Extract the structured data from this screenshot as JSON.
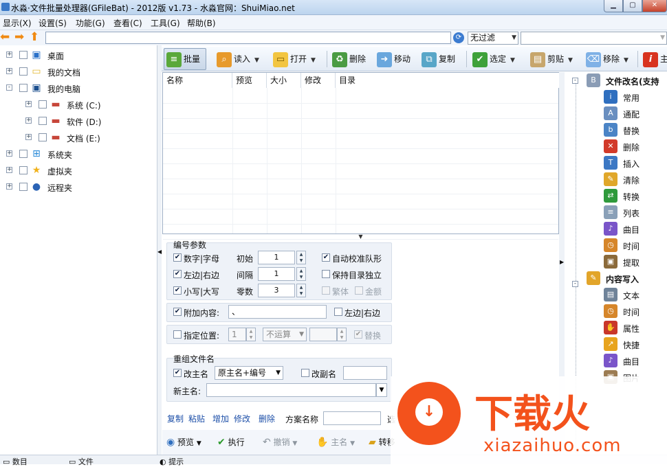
{
  "window": {
    "title": "水淼·文件批量处理器(GFileBat) - 2012版 v1.73 - 水淼官网：ShuiMiao.net"
  },
  "menu": [
    "显示(X)",
    "设置(S)",
    "功能(G)",
    "查看(C)",
    "工具(G)",
    "帮助(B)"
  ],
  "nav": {
    "path_value": "",
    "filter_value": "无过滤",
    "filter2_value": ""
  },
  "tree": [
    {
      "label": "桌面",
      "icon": "desktop-icon",
      "level": 0,
      "expand": "+"
    },
    {
      "label": "我的文档",
      "icon": "folder-icon",
      "level": 0,
      "expand": "+"
    },
    {
      "label": "我的电脑",
      "icon": "computer-icon",
      "level": 0,
      "expand": "-"
    },
    {
      "label": "系统 (C:)",
      "icon": "drive-icon",
      "level": 1,
      "expand": "+"
    },
    {
      "label": "软件 (D:)",
      "icon": "drive-icon",
      "level": 1,
      "expand": "+"
    },
    {
      "label": "文档 (E:)",
      "icon": "drive-icon",
      "level": 1,
      "expand": "+"
    },
    {
      "label": "系统夹",
      "icon": "windows-icon",
      "level": 0,
      "expand": "+"
    },
    {
      "label": "虚拟夹",
      "icon": "star-icon",
      "level": 0,
      "expand": "+"
    },
    {
      "label": "远程夹",
      "icon": "ftp-icon",
      "level": 0,
      "expand": "+"
    }
  ],
  "toolbar": {
    "batch": "批量",
    "read": "读入",
    "open": "打开",
    "delete": "删除",
    "move": "移动",
    "copy": "复制",
    "select": "选定",
    "clip": "剪贴",
    "remove": "移除",
    "info": "主"
  },
  "filelist": {
    "columns": [
      "名称",
      "预览",
      "大小",
      "修改",
      "目录"
    ]
  },
  "params": {
    "number_title": "编号参数",
    "digit_letter": "数字|字母",
    "left_right": "左边|右边",
    "lower_upper": "小写|大写",
    "start_label": "初始",
    "start_value": "1",
    "interval_label": "间隔",
    "interval_value": "1",
    "zeros_label": "零数",
    "zeros_value": "3",
    "auto_align": "自动校准队形",
    "keep_dir": "保持目录独立",
    "traditional": "繁体",
    "money": "金额",
    "append_label": "附加内容:",
    "append_value": "、",
    "append_left_right": "左边|右边",
    "position_label": "指定位置:",
    "position_value": "1",
    "operation_value": "不运算",
    "replace_label": "替换",
    "regroup_title": "重组文件名",
    "change_main": "改主名",
    "main_mode": "原主名+编号",
    "change_ext": "改副名",
    "new_main_label": "新主名:",
    "scheme_label": "方案名称",
    "select_label": "选"
  },
  "minibtns": [
    "复制",
    "粘贴",
    "增加",
    "修改",
    "删除"
  ],
  "bottom": {
    "preview": "预览",
    "execute": "执行",
    "undo": "撤销",
    "mainname": "主名",
    "transfer": "转移"
  },
  "righttree": {
    "rename_header": "文件改名(支持",
    "items": [
      "常用",
      "通配",
      "替换",
      "删除",
      "插入",
      "清除",
      "转换",
      "列表",
      "曲目",
      "时间",
      "提取"
    ],
    "write_header": "内容写入",
    "write_items": [
      "文本",
      "时间",
      "属性",
      "快捷",
      "曲目",
      "图片"
    ]
  },
  "status": {
    "count_label": "数目",
    "file_label": "文件",
    "tip_label": "提示"
  },
  "watermark": {
    "cn": "下载火",
    "en": "xiazaihuo.com"
  },
  "colors": {
    "accent": "#3b7bd0",
    "watermark": "#f3521c"
  }
}
